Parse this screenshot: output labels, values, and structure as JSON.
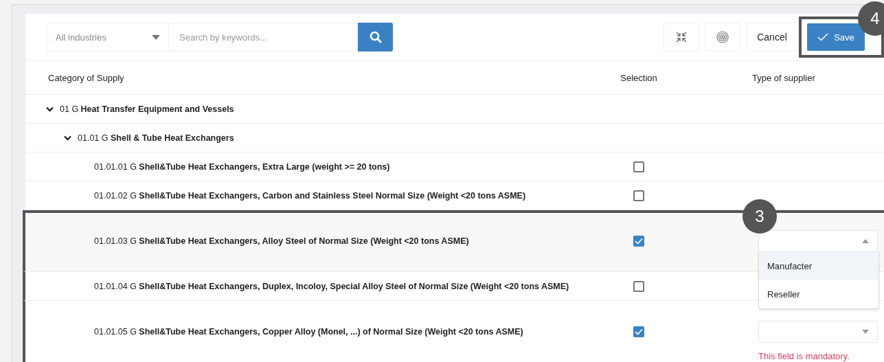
{
  "toolbar": {
    "industry_select": {
      "value": "All industries"
    },
    "search": {
      "placeholder": "Search by keywords..."
    },
    "cancel_button": "Cancel",
    "save_button": {
      "label": "Save",
      "callout": "4"
    }
  },
  "columns": [
    "Category of Supply",
    "Selection",
    "Type of supplier"
  ],
  "tree": [
    {
      "label": "01 G **Heat Transfer Equipment and Vessels**",
      "expanded": true,
      "children": [
        {
          "label": "01.01 G **Shell & Tube Heat Exchangers**",
          "expanded": true,
          "children": [
            {
              "label": "01.01.01 G **Shell&Tube Heat Exchangers, Extra Large (weight >= 20 tons)**",
              "checked": false,
              "framed": false
            },
            {
              "label": "01.01.02 G **Shell&Tube Heat Exchangers, Carbon and Stainless Steel Normal Size (Weight <20 tons ASME)**",
              "checked": false,
              "framed": false
            },
            {
              "label": "01.01.03 G **Shell&Tube Heat Exchangers, Alloy Steel of Normal Size (Weight <20 tons ASME)**",
              "checked": true,
              "framed": true,
              "callout": "3",
              "supplier": {
                "expanded": true,
                "options": [
                  {
                    "label": "Manufacter",
                    "selected": true
                  },
                  {
                    "label": "Reseller",
                    "selected": false
                  }
                ]
              }
            },
            {
              "label": "01.01.04 G **Shell&Tube Heat Exchangers, Duplex, Incoloy, Special Alloy Steel of Normal Size (Weight <20 tons ASME)**",
              "checked": false,
              "framed": true
            },
            {
              "label": "01.01.05 G **Shell&Tube Heat Exchangers, Copper Alloy (Monel, ...) of Normal Size (Weight <20 tons ASME)**",
              "checked": true,
              "framed": true,
              "supplier": {
                "expanded": false,
                "error": "This field is mandatory."
              }
            }
          ]
        }
      ]
    }
  ]
}
